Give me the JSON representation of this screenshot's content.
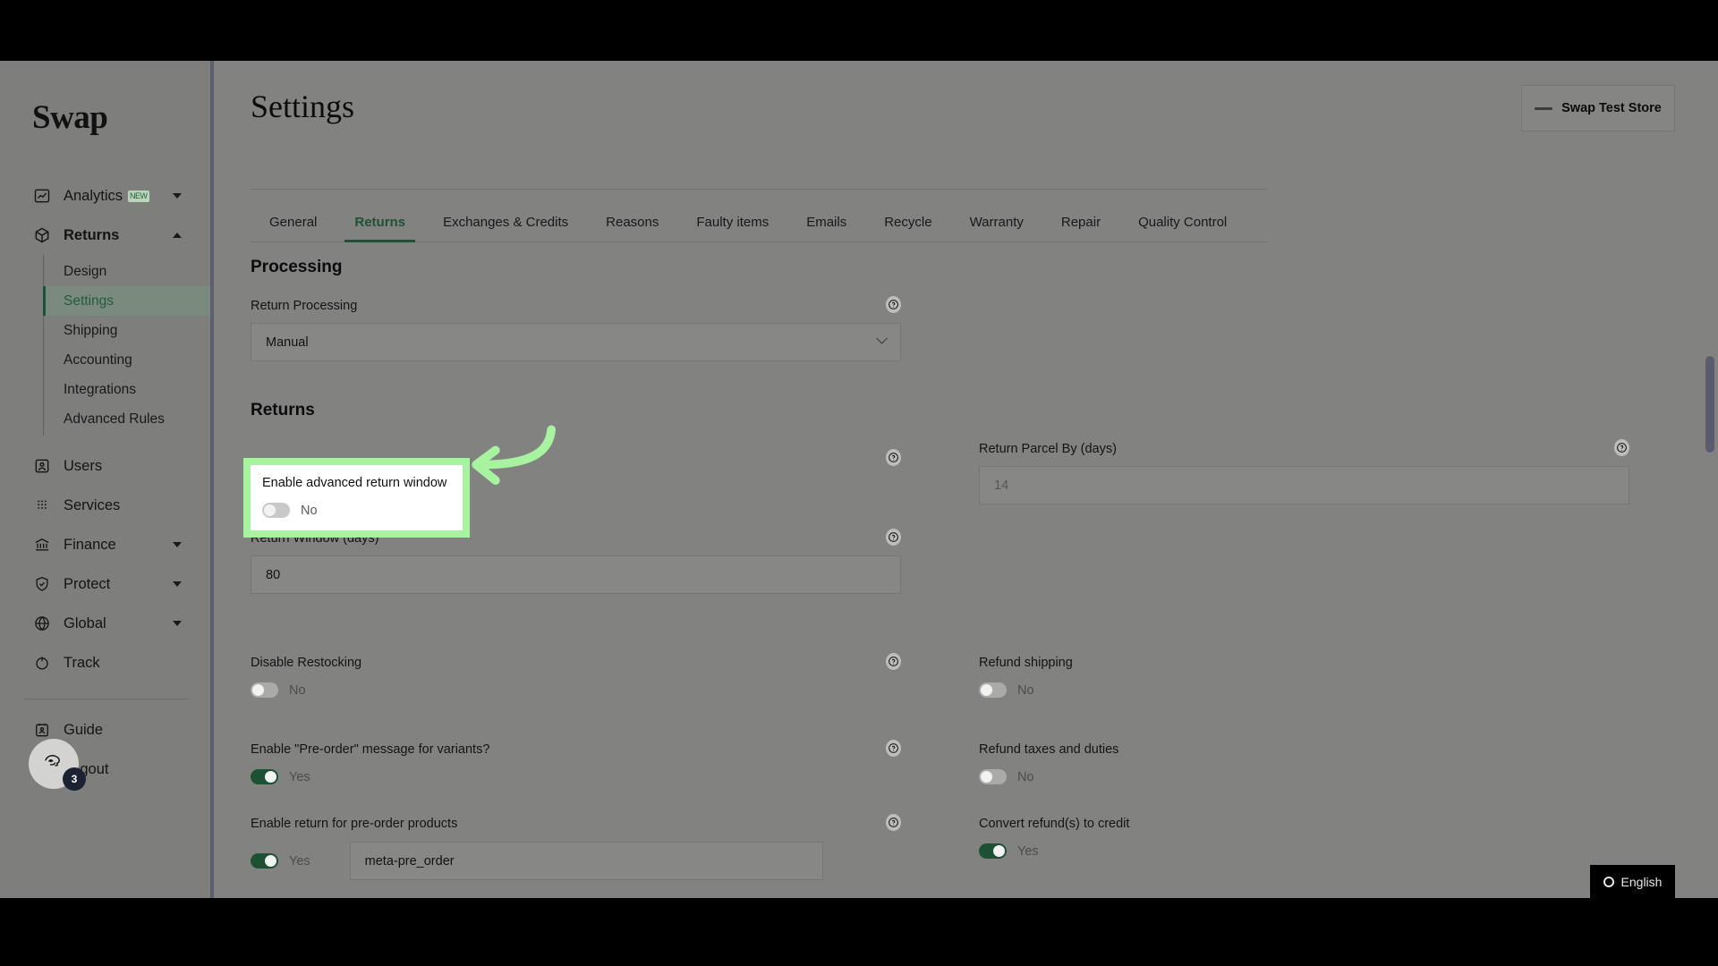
{
  "brand": {
    "name": "Swap"
  },
  "sidebar": {
    "items": [
      {
        "label": "Analytics",
        "icon": "analytics-icon",
        "badge": "NEW",
        "caret": "down"
      },
      {
        "label": "Returns",
        "icon": "package-icon",
        "caret": "up",
        "bold": true
      },
      {
        "label": "Users",
        "icon": "user-card-icon"
      },
      {
        "label": "Services",
        "icon": "grid-dots-icon"
      },
      {
        "label": "Finance",
        "icon": "bank-icon",
        "caret": "down"
      },
      {
        "label": "Protect",
        "icon": "shield-check-icon",
        "caret": "down"
      },
      {
        "label": "Global",
        "icon": "globe-icon",
        "caret": "down"
      },
      {
        "label": "Track",
        "icon": "track-icon"
      }
    ],
    "returns_subitems": [
      {
        "label": "Design",
        "active": false
      },
      {
        "label": "Settings",
        "active": true
      },
      {
        "label": "Shipping",
        "active": false
      },
      {
        "label": "Accounting",
        "active": false
      },
      {
        "label": "Integrations",
        "active": false
      },
      {
        "label": "Advanced Rules",
        "active": false
      }
    ],
    "footer": [
      {
        "label": "Guide",
        "icon": "guide-icon"
      },
      {
        "label": "Logout",
        "icon": "logout-icon"
      }
    ],
    "avatar_badge_count": "3"
  },
  "header": {
    "title": "Settings",
    "store_button": "Swap Test Store"
  },
  "tabs": [
    {
      "label": "General",
      "active": false
    },
    {
      "label": "Returns",
      "active": true
    },
    {
      "label": "Exchanges & Credits",
      "active": false
    },
    {
      "label": "Reasons",
      "active": false
    },
    {
      "label": "Faulty items",
      "active": false
    },
    {
      "label": "Emails",
      "active": false
    },
    {
      "label": "Recycle",
      "active": false
    },
    {
      "label": "Warranty",
      "active": false
    },
    {
      "label": "Repair",
      "active": false
    },
    {
      "label": "Quality Control",
      "active": false
    }
  ],
  "sections": {
    "processing_title": "Processing",
    "returns_title": "Returns"
  },
  "fields": {
    "return_processing": {
      "label": "Return Processing",
      "value": "Manual"
    },
    "enable_advanced_return_window": {
      "label": "Enable advanced return window",
      "state": "No"
    },
    "return_window_days": {
      "label": "Return Window (days)",
      "value": "80"
    },
    "return_parcel_by_days": {
      "label": "Return Parcel By (days)",
      "placeholder": "14"
    },
    "disable_restocking": {
      "label": "Disable Restocking",
      "state": "No"
    },
    "refund_shipping": {
      "label": "Refund shipping",
      "state": "No"
    },
    "preorder_message_variants": {
      "label": "Enable \"Pre-order\" message for variants?",
      "state": "Yes"
    },
    "refund_taxes_duties": {
      "label": "Refund taxes and duties",
      "state": "No"
    },
    "enable_return_preorder_products": {
      "label": "Enable return for pre-order products",
      "state": "Yes",
      "value": "meta-pre_order"
    },
    "convert_refunds_to_credit": {
      "label": "Convert refund(s) to credit",
      "state": "Yes"
    }
  },
  "language_widget": {
    "label": "English"
  },
  "colors": {
    "accent_green": "#1f5134",
    "highlight_green": "#a8f3a0",
    "badge_dark": "#1b2232"
  }
}
